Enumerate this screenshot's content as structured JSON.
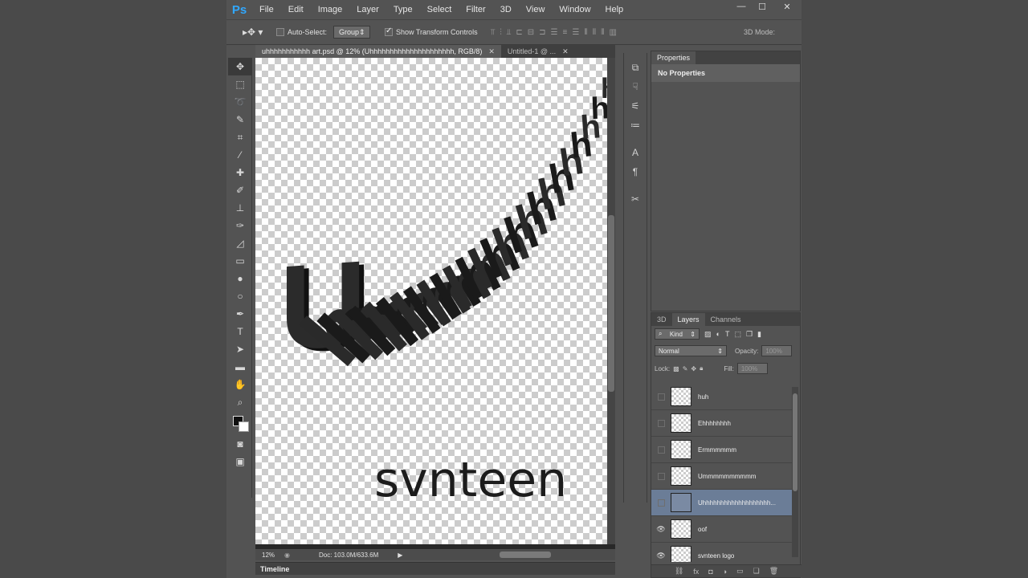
{
  "app": {
    "logo": "Ps",
    "menu": [
      "File",
      "Edit",
      "Image",
      "Layer",
      "Type",
      "Select",
      "Filter",
      "3D",
      "View",
      "Window",
      "Help"
    ],
    "window_controls": {
      "minimize": "—",
      "maximize": "☐",
      "close": "✕"
    }
  },
  "options": {
    "auto_select_label": "Auto-Select:",
    "auto_select_value": "Group",
    "show_transform_label": "Show Transform Controls",
    "mode_3d_label": "3D Mode:"
  },
  "tabs": [
    {
      "label": "uhhhhhhhhhhh art.psd @ 12% (Uhhhhhhhhhhhhhhhhhhhhh, RGB/8)",
      "close": "✕"
    },
    {
      "label": "Untitled-1 @ ...",
      "close": "✕"
    }
  ],
  "canvas": {
    "big_letter": "U",
    "trail_letters": "hhhhhhhhhhhhhhhhhhhhhhhhh",
    "logo_text": "svnteen"
  },
  "status": {
    "zoom": "12%",
    "doc": "Doc: 103.0M/633.6M"
  },
  "timeline_label": "Timeline",
  "properties": {
    "tab_label": "Properties",
    "body": "No Properties"
  },
  "layers_panel": {
    "tabs": [
      "3D",
      "Layers",
      "Channels"
    ],
    "kind_label": "Kind",
    "blend_mode": "Normal",
    "opacity_label": "Opacity:",
    "opacity_value": "100%",
    "lock_label": "Lock:",
    "fill_label": "Fill:",
    "fill_value": "100%",
    "layers": [
      {
        "name": "huh",
        "visible": false,
        "selected": false
      },
      {
        "name": "Ehhhhhhhh",
        "visible": false,
        "selected": false
      },
      {
        "name": "Ermmmmmm",
        "visible": false,
        "selected": false
      },
      {
        "name": "Ummmmmmmmmm",
        "visible": false,
        "selected": false
      },
      {
        "name": "Uhhhhhhhhhhhhhhhhhhh...",
        "visible": false,
        "selected": true
      },
      {
        "name": "oof",
        "visible": true,
        "selected": false
      },
      {
        "name": "svnteen logo",
        "visible": true,
        "selected": false
      }
    ]
  }
}
